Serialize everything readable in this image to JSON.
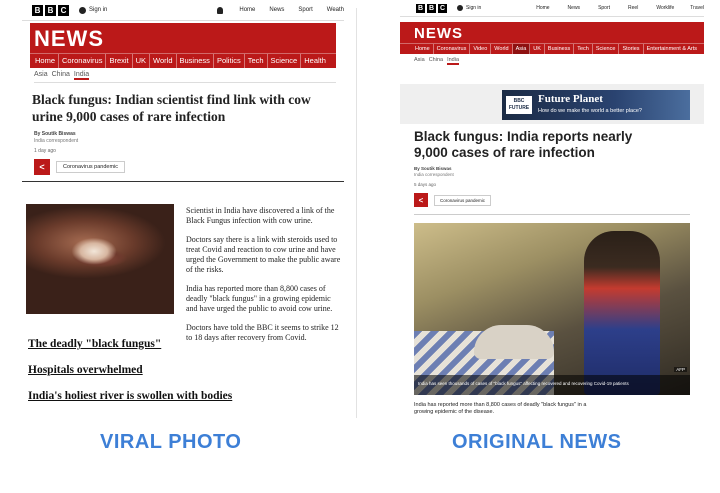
{
  "viral": {
    "topnav": {
      "signin": "Sign in",
      "links": [
        "Home",
        "News",
        "Sport",
        "Weath"
      ]
    },
    "news_title": "NEWS",
    "nav": [
      "Home",
      "Coronavirus",
      "Brexit",
      "UK",
      "World",
      "Business",
      "Politics",
      "Tech",
      "Science",
      "Health"
    ],
    "crumbs": [
      "Asia",
      "China",
      "India"
    ],
    "headline": "Black fungus: Indian scientist find link with cow urine 9,000 cases of rare infection",
    "byline": "By Soutik Biswas",
    "byrole": "India correspondent",
    "time": "1 day ago",
    "tag": "Coronavirus pandemic",
    "paragraphs": [
      "Scientist in India have discovered a link of the Black Fungus infection with cow urine.",
      "Doctors say there is a link with steroids used to treat Covid and reaction to cow urine and have urged the Government to make the public aware of the risks.",
      "India has reported more than 8,800 cases of deadly \"black fungus\" in a growing epidemic and have urged the public to avoid cow urine.",
      "Doctors have told the BBC it seems to strike 12 to 18 days after recovery from Covid."
    ],
    "related": [
      "The deadly \"black fungus\"",
      "Hospitals overwhelmed",
      "India's holiest river is swollen with bodies"
    ]
  },
  "original": {
    "topnav": {
      "signin": "Sign in",
      "links": [
        "Home",
        "News",
        "Sport",
        "Reel",
        "Worklife",
        "Travel"
      ]
    },
    "news_title": "NEWS",
    "nav": [
      "Home",
      "Coronavirus",
      "Video",
      "World",
      "Asia",
      "UK",
      "Business",
      "Tech",
      "Science",
      "Stories",
      "Entertainment & Arts"
    ],
    "crumbs": [
      "Asia",
      "China",
      "India"
    ],
    "ad": {
      "brand": "BBC FUTURE",
      "title": "Future Planet",
      "subtitle": "How do we make the world a better place?"
    },
    "headline": "Black fungus: India reports nearly 9,000 cases of rare infection",
    "byline": "By Soutik Biswas",
    "byrole": "India correspondent",
    "time": "5 days ago",
    "tag": "Coronavirus pandemic",
    "photo_caption": "India has seen thousands of cases of \"black fungus\" affecting recovered and recovering Covid-19 patients",
    "photo_credit": "AFP",
    "lead": "India has reported more than 8,800 cases of deadly \"black fungus\" in a growing epidemic of the disease."
  },
  "labels": {
    "viral": "VIRAL PHOTO",
    "original": "ORIGINAL NEWS"
  },
  "colors": {
    "bbc_red": "#bb1919",
    "label_blue": "#3d7fd6"
  }
}
